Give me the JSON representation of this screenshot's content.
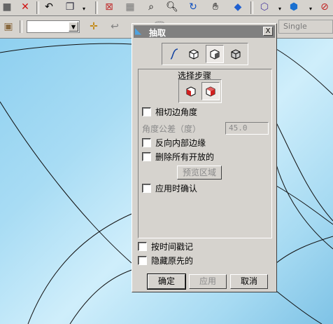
{
  "toolbar_top": {
    "icons": [
      "delete-icon",
      "undo-icon",
      "copy-icon",
      "fit-view-icon",
      "zoom-window-icon",
      "zoom-icon",
      "rotate-icon",
      "pan-hand-icon",
      "shade-icon",
      "wireframe-cube-icon",
      "solid-cube-icon",
      "stop-icon"
    ]
  },
  "toolbar_second": {
    "combo_value": "",
    "single_field": "Single"
  },
  "dialog": {
    "title": "抽取",
    "close_label": "X",
    "step_group_label": "选择步骤",
    "options": {
      "tangent_angle": "相切边角度",
      "angle_tolerance_label": "角度公差（度）",
      "angle_tolerance_value": "45.0",
      "reverse_inner_edges": "反向内部边缘",
      "delete_all_open": "删除所有开放的",
      "preview_region": "预览区域",
      "confirm_on_apply": "应用时确认",
      "timestamp": "按时间戳记",
      "hide_original": "隐藏原先的"
    },
    "buttons": {
      "ok": "确定",
      "apply": "应用",
      "cancel": "取消"
    }
  },
  "colors": {
    "viewport": "#a8dcf4",
    "dialog_bg": "#d6d3ce",
    "titlebar": "#808080",
    "disabled_text": "#8a8a8a"
  }
}
